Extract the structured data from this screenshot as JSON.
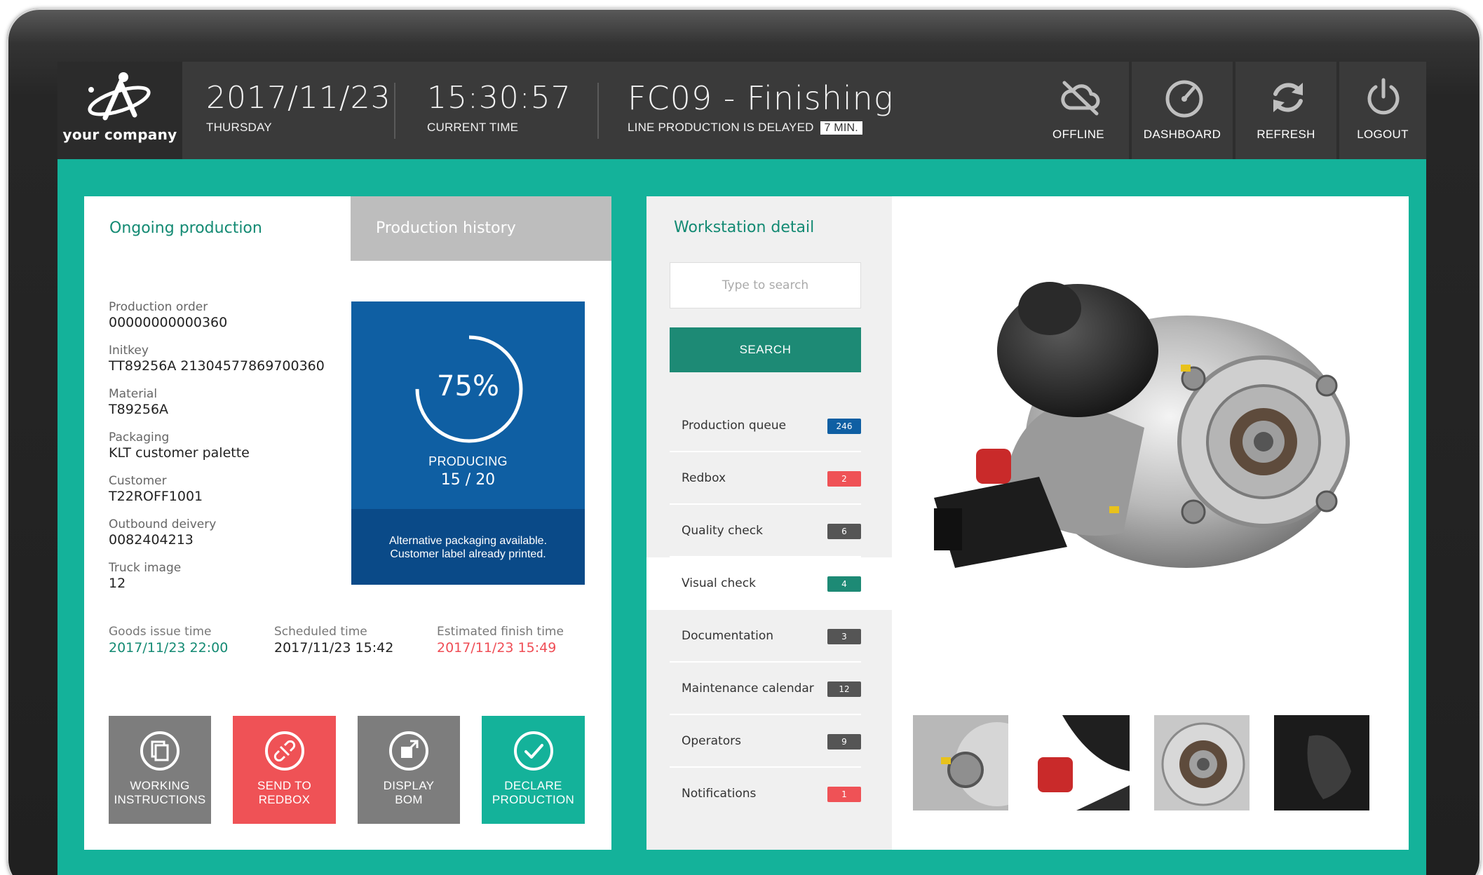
{
  "header": {
    "logo_text": "your company",
    "date": "2017/11/23",
    "day": "THURSDAY",
    "time": "15:30:57",
    "time_label": "CURRENT TIME",
    "line_title": "FC09 - Finishing",
    "status_text": "LINE PRODUCTION IS DELAYED",
    "delay_badge": "7 MIN.",
    "buttons": [
      {
        "label": "OFFLINE",
        "icon": "cloud-offline-icon"
      },
      {
        "label": "DASHBOARD",
        "icon": "gauge-icon"
      },
      {
        "label": "REFRESH",
        "icon": "refresh-icon"
      },
      {
        "label": "LOGOUT",
        "icon": "power-icon"
      }
    ]
  },
  "production": {
    "tabs": {
      "active": "Ongoing production",
      "inactive": "Production history"
    },
    "fields": [
      {
        "label": "Production order",
        "value": "00000000000360"
      },
      {
        "label": "Initkey",
        "value": "TT89256A 21304577869700360"
      },
      {
        "label": "Material",
        "value": "T89256A"
      },
      {
        "label": "Packaging",
        "value": "KLT customer palette"
      },
      {
        "label": "Customer",
        "value": "T22ROFF1001"
      },
      {
        "label": "Outbound deivery",
        "value": "0082404213"
      },
      {
        "label": "Truck image",
        "value": "12"
      }
    ],
    "progress": {
      "percent_text": "75%",
      "fraction": 0.75,
      "status": "PRODUCING",
      "count": "15 / 20",
      "note_line1": "Alternative packaging available.",
      "note_line2": "Customer label already printed."
    },
    "times": [
      {
        "label": "Goods issue time",
        "value": "2017/11/23 22:00",
        "color": "#138a73"
      },
      {
        "label": "Scheduled time",
        "value": "2017/11/23 15:42",
        "color": "#222222"
      },
      {
        "label": "Estimated finish time",
        "value": "2017/11/23 15:49",
        "color": "#ef4d55"
      }
    ],
    "actions": [
      {
        "line1": "WORKING",
        "line2": "INSTRUCTIONS",
        "color": "#7d7d7d",
        "icon": "documents-icon"
      },
      {
        "line1": "SEND TO",
        "line2": "REDBOX",
        "color": "#ef5256",
        "icon": "broken-link-icon"
      },
      {
        "line1": "DISPLAY",
        "line2": "BOM",
        "color": "#7d7d7d",
        "icon": "bom-icon"
      },
      {
        "line1": "DECLARE",
        "line2": "PRODUCTION",
        "color": "#14b29a",
        "icon": "check-icon"
      }
    ]
  },
  "workstation": {
    "title": "Workstation detail",
    "search_placeholder": "Type to search",
    "search_button": "SEARCH",
    "items": [
      {
        "name": "Production queue",
        "count": "246",
        "color": "#0f5fa3"
      },
      {
        "name": "Redbox",
        "count": "2",
        "color": "#ef5256"
      },
      {
        "name": "Quality check",
        "count": "6",
        "color": "#555555"
      },
      {
        "name": "Visual check",
        "count": "4",
        "color": "#1d8a75"
      },
      {
        "name": "Documentation",
        "count": "3",
        "color": "#555555"
      },
      {
        "name": "Maintenance calendar",
        "count": "12",
        "color": "#555555"
      },
      {
        "name": "Operators",
        "count": "9",
        "color": "#555555"
      },
      {
        "name": "Notifications",
        "count": "1",
        "color": "#ef5256"
      }
    ],
    "selected_item": "Visual check"
  }
}
